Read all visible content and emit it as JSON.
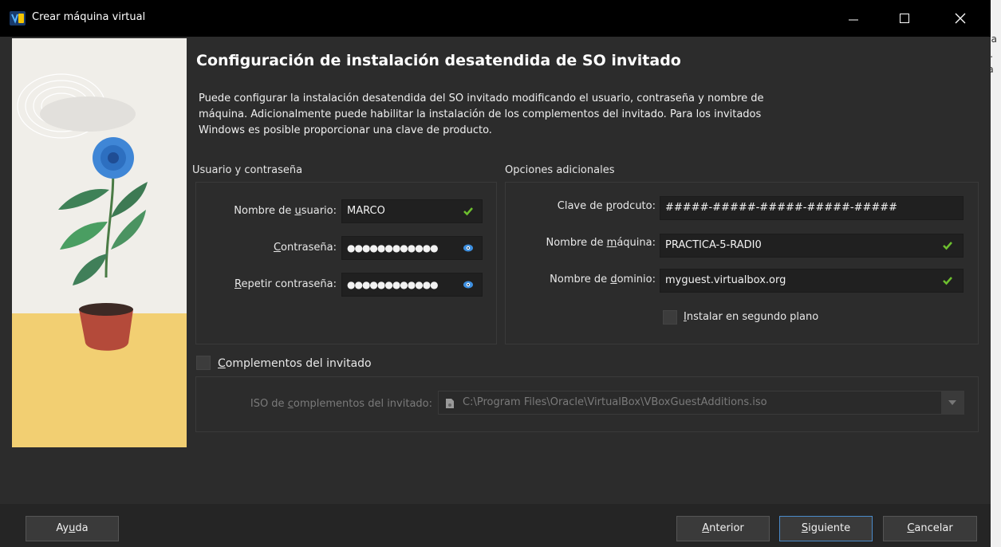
{
  "window": {
    "title": "Crear máquina virtual"
  },
  "background_text": {
    "line1": "na",
    "line2": "s.",
    "line3": "la"
  },
  "page": {
    "heading": "Configuración de instalación desatendida de SO invitado",
    "description_line1": "Puede configurar la instalación desatendida del SO invitado modificando el usuario, contraseña y nombre de",
    "description_line2": "máquina. Adicionalmente puede habilitar la instalación de los complementos del invitado. Para los invitados",
    "description_line3": "Windows es posible proporcionar una clave de producto."
  },
  "user_section": {
    "title": "Usuario y contraseña",
    "username": {
      "label_pre": "Nombre de ",
      "label_u": "u",
      "label_post": "suario:",
      "value": "MARCO"
    },
    "password": {
      "label_u": "C",
      "label_post": "ontraseña:",
      "value": "●●●●●●●●●●●●"
    },
    "repeat_password": {
      "label_u": "R",
      "label_post": "epetir contraseña:",
      "value": "●●●●●●●●●●●●"
    }
  },
  "options_section": {
    "title": "Opciones adicionales",
    "product_key": {
      "label_pre": "Clave de ",
      "label_u": "p",
      "label_post": "rodcuto:",
      "value": "#####-#####-#####-#####-#####"
    },
    "machine_name": {
      "label_pre": "Nombre de ",
      "label_u": "m",
      "label_post": "áquina:",
      "value": "PRACTICA-5-RADI0"
    },
    "domain_name": {
      "label_pre": "Nombre de ",
      "label_u": "d",
      "label_post": "ominio:",
      "value": "myguest.virtualbox.org"
    },
    "background_install": {
      "label_u": "I",
      "label_post": "nstalar en segundo plano",
      "checked": false
    }
  },
  "guest_additions": {
    "checkbox": {
      "label_u": "C",
      "label_post": "omplementos del invitado",
      "checked": false
    },
    "iso": {
      "label_pre": "ISO de ",
      "label_u": "c",
      "label_post": "omplementos del invitado:",
      "value": "C:\\Program Files\\Oracle\\VirtualBox\\VBoxGuestAdditions.iso"
    }
  },
  "buttons": {
    "help": {
      "pre": "Ay",
      "u": "u",
      "post": "da"
    },
    "back": {
      "u": "A",
      "post": "nterior"
    },
    "next": {
      "u": "S",
      "post": "iguiente"
    },
    "cancel": {
      "u": "C",
      "post": "ancelar"
    }
  },
  "colors": {
    "background": "#2c2c2c",
    "titlebar": "#000000",
    "input": "#202020",
    "check": "#6dbf2e",
    "accent": "#4a8ac9"
  },
  "icons": [
    "virtualbox-icon",
    "minimize-icon",
    "maximize-icon",
    "close-icon",
    "check-icon",
    "eye-icon",
    "file-icon",
    "dropdown-arrow-icon"
  ]
}
